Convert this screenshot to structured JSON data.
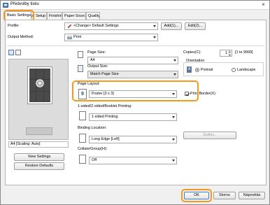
{
  "window": {
    "title": "Předvolby tisku",
    "close_glyph": "×"
  },
  "tabs": [
    {
      "label": "Basic Settings"
    },
    {
      "label": "Page Setup"
    },
    {
      "label": "Finishing"
    },
    {
      "label": "Paper Source"
    },
    {
      "label": "Quality"
    }
  ],
  "profile": {
    "label": "Profile:",
    "value": "<Change> Default Settings",
    "add_label": "Add(1)...",
    "edit_label": "Edit(2)..."
  },
  "output_method": {
    "label": "Output Method:",
    "value": "Print"
  },
  "preview": {
    "status": "A4 [Scaling: Auto]"
  },
  "page_size": {
    "label": "Page Size:",
    "value": "A4"
  },
  "output_size": {
    "label": "Output Size:",
    "value": "Match Page Size"
  },
  "copies": {
    "label": "Copies(C):",
    "value": "1",
    "range": "[1 to 9999]"
  },
  "orientation": {
    "label": "Orientation",
    "portrait_label": "Portrait",
    "landscape_label": "Landscape",
    "portrait_selected": true
  },
  "page_layout": {
    "label": "Page Layout:",
    "value": "Poster [3 x 3]",
    "icon_text": "9",
    "print_border_label": "Print Border(X)",
    "print_border_checked": true
  },
  "printing": {
    "label": "1-sided/2-sided/Booklet Printing:",
    "value": "1-sided Printing"
  },
  "binding": {
    "label": "Binding Location:",
    "value": "Long Edge [Left]",
    "gutter_label": "Gutter..."
  },
  "collate": {
    "label": "Collate/Group(H):",
    "value": "Off"
  },
  "buttons": {
    "view_settings": "View Settings",
    "restore_defaults": "Restore Defaults",
    "ok": "OK",
    "cancel": "Storno",
    "help": "Nápověda"
  },
  "accent_color": "#f39a1e"
}
